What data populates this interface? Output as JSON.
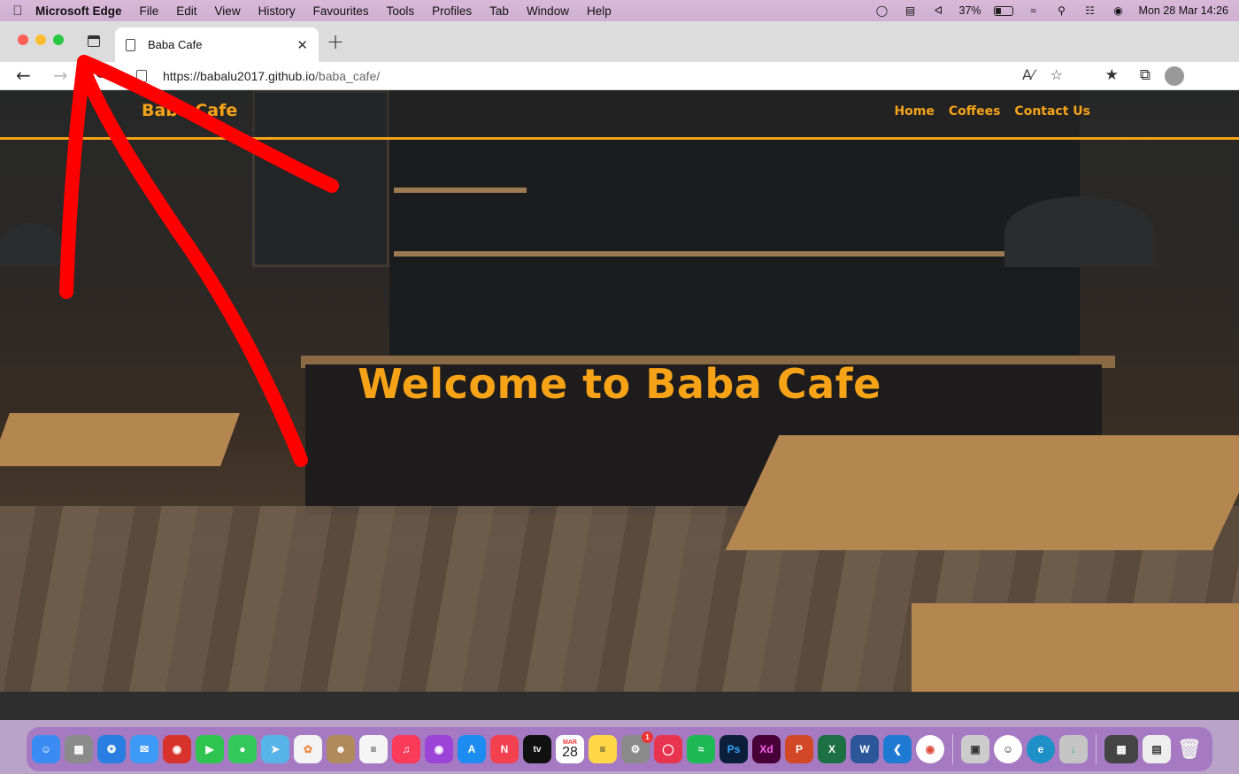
{
  "menubar": {
    "app_name": "Microsoft Edge",
    "menus": [
      "File",
      "Edit",
      "View",
      "History",
      "Favourites",
      "Tools",
      "Profiles",
      "Tab",
      "Window",
      "Help"
    ],
    "battery_percent": "37%",
    "battery_level": 0.37,
    "datetime": "Mon 28 Mar  14:26"
  },
  "browser": {
    "tab_title": "Baba Cafe",
    "url_host": "https://babalu2017.github.io",
    "url_path": "/baba_cafe/"
  },
  "site": {
    "logo": "Baba Cafe",
    "nav": [
      "Home",
      "Coffees",
      "Contact Us"
    ],
    "hero_title": "Welcome to Baba Cafe",
    "accent_color": "#f6a317"
  },
  "annotation": {
    "color": "#ff0000",
    "shape": "hand-drawn arrow pointing to sidebar toggle"
  },
  "dock": {
    "calendar_month": "MAR",
    "calendar_day": "28",
    "badge_count": "1",
    "apps": [
      "finder-icon",
      "launchpad-icon",
      "safari-icon",
      "mail-icon",
      "photo-booth-icon",
      "facetime-icon",
      "messages-icon",
      "maps-icon",
      "photos-icon",
      "contacts-icon",
      "calendar-icon",
      "reminders-icon",
      "music-icon",
      "podcasts-icon",
      "app-store-icon",
      "news-icon",
      "apple-tv-icon",
      "notes-icon",
      "system-preferences-icon",
      "creative-cloud-icon",
      "spotify-icon",
      "photoshop-icon",
      "xd-icon",
      "powerpoint-icon",
      "excel-icon",
      "word-icon",
      "vscode-icon",
      "chrome-icon",
      "preview-icon",
      "finder-face-icon",
      "edge-icon",
      "installer-icon",
      "screenshots-icon",
      "downloads-icon",
      "trash-icon"
    ]
  }
}
